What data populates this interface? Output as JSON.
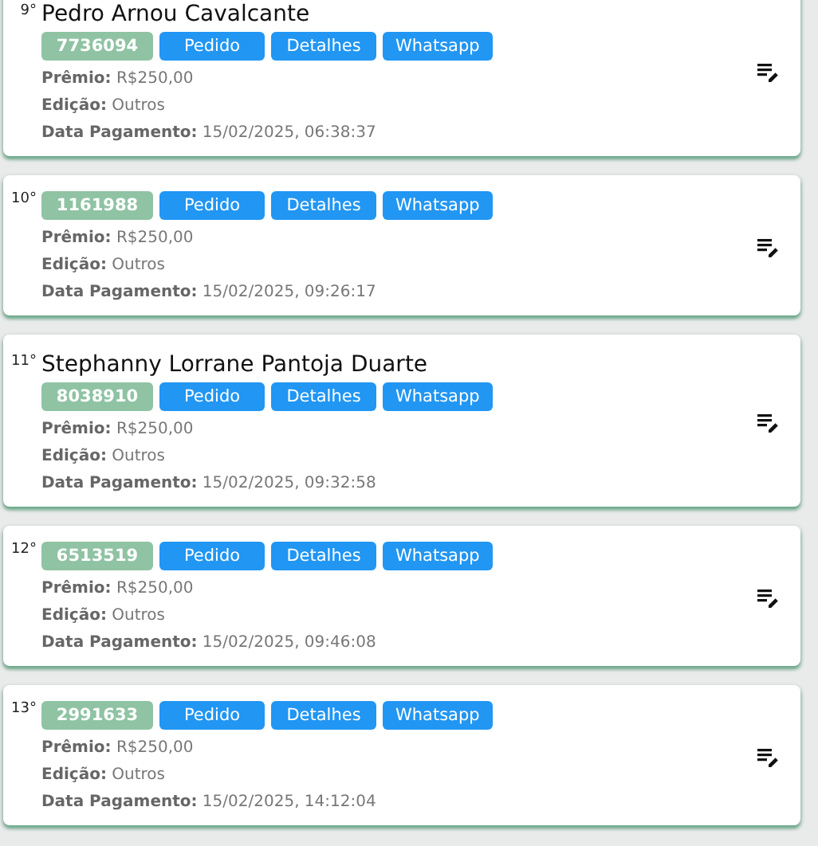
{
  "entries": [
    {
      "rank": "9°",
      "name": "Pedro Arnou Cavalcante",
      "code": "7736094",
      "buttons": [
        "Pedido",
        "Detalhes",
        "Whatsapp"
      ],
      "fields": [
        {
          "label": "Prêmio:",
          "value": "R$250,00"
        },
        {
          "label": "Edição:",
          "value": "Outros"
        },
        {
          "label": "Data Pagamento:",
          "value": "15/02/2025, 06:38:37"
        }
      ]
    },
    {
      "rank": "10°",
      "code": "1161988",
      "buttons": [
        "Pedido",
        "Detalhes",
        "Whatsapp"
      ],
      "fields": [
        {
          "label": "Prêmio:",
          "value": "R$250,00"
        },
        {
          "label": "Edição:",
          "value": "Outros"
        },
        {
          "label": "Data Pagamento:",
          "value": "15/02/2025, 09:26:17"
        }
      ]
    },
    {
      "rank": "11°",
      "name": "Stephanny Lorrane Pantoja Duarte",
      "code": "8038910",
      "buttons": [
        "Pedido",
        "Detalhes",
        "Whatsapp"
      ],
      "fields": [
        {
          "label": "Prêmio:",
          "value": "R$250,00"
        },
        {
          "label": "Edição:",
          "value": "Outros"
        },
        {
          "label": "Data Pagamento:",
          "value": "15/02/2025, 09:32:58"
        }
      ]
    },
    {
      "rank": "12°",
      "code": "6513519",
      "buttons": [
        "Pedido",
        "Detalhes",
        "Whatsapp"
      ],
      "fields": [
        {
          "label": "Prêmio:",
          "value": "R$250,00"
        },
        {
          "label": "Edição:",
          "value": "Outros"
        },
        {
          "label": "Data Pagamento:",
          "value": "15/02/2025, 09:46:08"
        }
      ]
    },
    {
      "rank": "13°",
      "code": "2991633",
      "buttons": [
        "Pedido",
        "Detalhes",
        "Whatsapp"
      ],
      "fields": [
        {
          "label": "Prêmio:",
          "value": "R$250,00"
        },
        {
          "label": "Edição:",
          "value": "Outros"
        },
        {
          "label": "Data Pagamento:",
          "value": "15/02/2025, 14:12:04"
        }
      ]
    }
  ]
}
